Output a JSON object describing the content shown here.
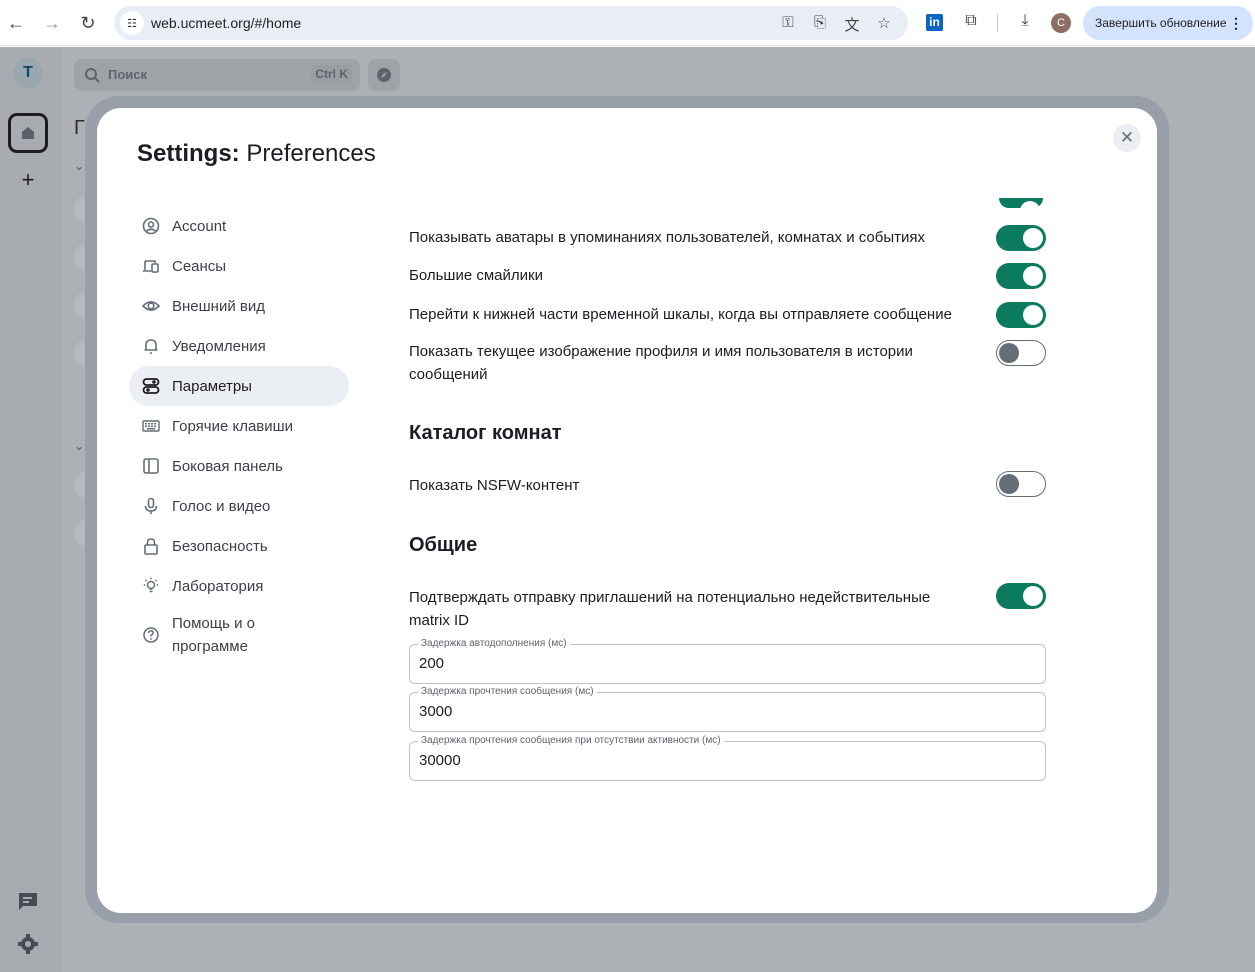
{
  "browser": {
    "url": "web.ucmeet.org/#/home",
    "profile_initial": "C",
    "update_button": "Завершить обновление"
  },
  "app": {
    "space_avatar_initial": "T",
    "search_placeholder": "Поиск",
    "search_shortcut": "Ctrl K",
    "room_list_heading_partial": "Г"
  },
  "modal": {
    "title_bold": "Settings:",
    "title_rest": "Preferences",
    "tabs": [
      {
        "label": "Account",
        "icon": "user-circle-icon",
        "active": false
      },
      {
        "label": "Сеансы",
        "icon": "devices-icon",
        "active": false
      },
      {
        "label": "Внешний вид",
        "icon": "eye-icon",
        "active": false
      },
      {
        "label": "Уведомления",
        "icon": "bell-icon",
        "active": false
      },
      {
        "label": "Параметры",
        "icon": "preferences-icon",
        "active": true
      },
      {
        "label": "Горячие клавиши",
        "icon": "keyboard-icon",
        "active": false
      },
      {
        "label": "Боковая панель",
        "icon": "sidebar-icon",
        "active": false
      },
      {
        "label": "Голос и видео",
        "icon": "microphone-icon",
        "active": false
      },
      {
        "label": "Безопасность",
        "icon": "lock-icon",
        "active": false
      },
      {
        "label": "Лаборатория",
        "icon": "lightbulb-icon",
        "active": false
      },
      {
        "label": "Помощь и о программе",
        "icon": "help-icon",
        "active": false
      }
    ],
    "settings": [
      {
        "label": "Показывать аватары в упоминаниях пользователей, комнатах и событиях",
        "enabled": true
      },
      {
        "label": "Большие смайлики",
        "enabled": true
      },
      {
        "label": "Перейти к нижней части временной шкалы, когда вы отправляете сообщение",
        "enabled": true
      },
      {
        "label": "Показать текущее изображение профиля и имя пользователя в истории сообщений",
        "enabled": false
      }
    ],
    "room_directory": {
      "heading": "Каталог комнат",
      "settings": [
        {
          "label": "Показать NSFW-контент",
          "enabled": false
        }
      ]
    },
    "general": {
      "heading": "Общие",
      "settings": [
        {
          "label": "Подтверждать отправку приглашений на потенциально недействительные matrix ID",
          "enabled": true
        }
      ],
      "fields": [
        {
          "label": "Задержка автодополнения (мс)",
          "value": "200"
        },
        {
          "label": "Задержка прочтения сообщения (мс)",
          "value": "3000"
        },
        {
          "label": "Задержка прочтения сообщения при отсутствии активности (мс)",
          "value": "30000"
        }
      ]
    }
  },
  "colors": {
    "accent": "#0b7b5f",
    "toggle_off": "#656d77"
  }
}
